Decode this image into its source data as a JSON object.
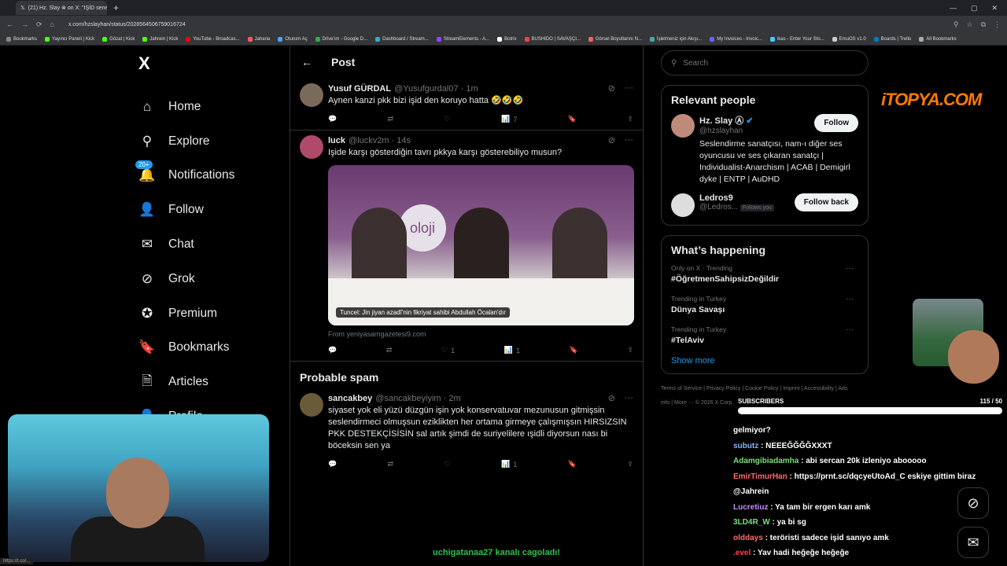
{
  "browser": {
    "tab_title": "(21) Hz. Slay ⊗ on X: \"IŞİD sene...",
    "url": "x.com/hzslayhan/status/2028564506759016724",
    "bookmarks": [
      "Bookmarks",
      "Yayıncı Paneli | Kick",
      "Gözat | Kick",
      "Jahrein | Kick",
      "YouTube - Broadcas...",
      "Jaharia",
      "Oturum Aç",
      "Drive'ım - Google D...",
      "Dashboard / Stream...",
      "StreamElements - A...",
      "Botrix",
      "BUSHIDO | SAVAŞÇI...",
      "Görsel Boyutlarını N...",
      "İşletmeniz için Akışı...",
      "My Invoices - Invoic...",
      "ikas - Enter Your Sto...",
      "EmuOS v1.0",
      "Boards | Trello",
      "All Bookmarks"
    ]
  },
  "nav": {
    "logo": "X",
    "badge": "20+",
    "items": [
      {
        "label": "Home",
        "icon": "⌂"
      },
      {
        "label": "Explore",
        "icon": "⚲"
      },
      {
        "label": "Notifications",
        "icon": "🔔"
      },
      {
        "label": "Follow",
        "icon": "👤"
      },
      {
        "label": "Chat",
        "icon": "✉"
      },
      {
        "label": "Grok",
        "icon": "⊘"
      },
      {
        "label": "Premium",
        "icon": "✪"
      },
      {
        "label": "Bookmarks",
        "icon": "🔖"
      },
      {
        "label": "Articles",
        "icon": "🗎"
      },
      {
        "label": "Profile",
        "icon": "👤"
      }
    ]
  },
  "main": {
    "header": "Post",
    "posts": [
      {
        "name": "Yusuf GÜRDAL",
        "handle": "@Yusufgurdal07 · 1m",
        "text": "Aynen kanzi pkk bizi işid den koruyo hatta 🤣🤣🤣",
        "views": "7",
        "likes": "",
        "retweets": ""
      },
      {
        "name": "luck",
        "handle": "@luckv2m · 14s",
        "text": "Işide karşı gösterdiğin tavrı pkkya karşı gösterebiliyo musun?",
        "views": "1",
        "likes": "1",
        "retweets": "",
        "media_caption": "Tuncel: Jin jiyan azadî'nin fikriyat sahibi Abdullah Öcalan'dır",
        "media_brand": "oloji",
        "source": "From yeniyasamgazetesi9.com"
      }
    ],
    "spam_title": "Probable spam",
    "spam_post": {
      "name": "sancakbey",
      "handle": "@sancakbeyiyim · 2m",
      "text": "siyaset yok eli yüzü düzgün işin yok konservatuvar mezunusun gitmişsin seslendirmeci olmuşsun eziklikten her ortama girmeye çalışmışsın HIRSIZSIN PKK DESTEKÇİSİSİN sal  artık şimdi de suriyelilere ışidli diyorsun nası bi böceksin sen ya",
      "views": "1"
    }
  },
  "right": {
    "search_placeholder": "Search",
    "relevant_title": "Relevant people",
    "people": [
      {
        "name": "Hz. Slay Ⓐ",
        "handle": "@hzslayhan",
        "bio": "Seslendirme sanatçısı, nam-ı diğer ses oyuncusu ve ses çıkaran sanatçı | Individualist-Anarchism | ACAB | Demigirl dyke | ENTP | AuDHD",
        "button": "Follow"
      },
      {
        "name": "Ledros9",
        "handle": "@Ledros...",
        "follows_you": "Follows you",
        "button": "Follow back"
      }
    ],
    "happening_title": "What’s happening",
    "trends": [
      {
        "meta": "Only on X · Trending",
        "name": "#ÖğretmenSahipsizDeğildir"
      },
      {
        "meta": "Trending in Turkey",
        "name": "Dünya Savaşı"
      },
      {
        "meta": "Trending in Turkey",
        "name": "#TelAviv"
      }
    ],
    "show_more": "Show more",
    "footer": "Terms of Service  |  Privacy Policy  |  Cookie Policy  |  Imprint  |  Accessibility  |  Ads info  |  More ···  © 2026 X Corp."
  },
  "overlay": {
    "brand": "iTOPYA.COM",
    "subs_label": "SUBSCRIBERS",
    "subs_count": "115 / 50",
    "subs_progress": 1.0,
    "chat": [
      {
        "user": "",
        "text": "gelmiyor?",
        "color": "#ffffff"
      },
      {
        "user": "subutz",
        "text": ": NEEEĞĞĞĞXXXT",
        "color": "#8ab4f8"
      },
      {
        "user": "Adamgibiadamha",
        "text": ": abi sercan 20k izleniyo abooooo",
        "color": "#7ddc7d"
      },
      {
        "user": "EmirTimurHan",
        "text": ": https://prnt.sc/dqcyeUtoAd_C eskiye gittim biraz @Jahrein",
        "color": "#ff6b6b"
      },
      {
        "user": "Lucretiuz",
        "text": ": Ya tam bir ergen karı amk",
        "color": "#c58af9"
      },
      {
        "user": "3LD4R_W",
        "text": ": ya bi sg",
        "color": "#7ddc7d"
      },
      {
        "user": "olddays",
        "text": ": teröristi sadece işid sanıyo amk",
        "color": "#ff6b6b"
      },
      {
        "user": ".evel",
        "text": ": Yav hadi heğeğe heğeğe",
        "color": "#ff4444"
      }
    ],
    "bottom_text": "uchigatanaa27 kanalı cagoladı!",
    "status_url": "https://t.co/..."
  }
}
